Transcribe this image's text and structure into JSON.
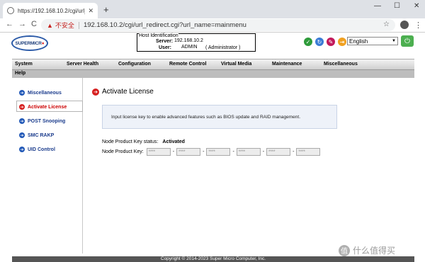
{
  "browser": {
    "tab_title": "https://192.168.10.2/cgi/url_re",
    "tab_close": "✕",
    "new_tab": "+",
    "window_controls": [
      "—",
      "☐",
      "✕"
    ],
    "nav_back": "←",
    "nav_forward": "→",
    "nav_reload": "C",
    "warning_icon": "▲",
    "insecure_label": "不安全",
    "url": "192.168.10.2/cgi/url_redirect.cgi?url_name=mainmenu",
    "star": "☆",
    "menu_dots": "⋮"
  },
  "header": {
    "logo_text": "SUPERMICR",
    "logo_dot": "●",
    "host_title": "Host Identification",
    "server_label": "Server:",
    "server_value": "192.168.10.2",
    "user_label": "User:",
    "user_value": "ADMIN",
    "user_role": "( Administrator )",
    "language": "English",
    "language_arrow": "▼",
    "icons": [
      {
        "name": "check-icon",
        "glyph": "✓",
        "color": "#2e9b3a"
      },
      {
        "name": "refresh-icon",
        "glyph": "↻",
        "color": "#3a7bd5"
      },
      {
        "name": "pen-icon",
        "glyph": "✎",
        "color": "#c2185b"
      },
      {
        "name": "logout-icon",
        "glyph": "⇥",
        "color": "#f0a020"
      }
    ],
    "power_glyph": "⏻"
  },
  "menu": {
    "items": [
      "System",
      "Server Health",
      "Configuration",
      "Remote Control",
      "Virtual Media",
      "Maintenance",
      "Miscellaneous"
    ],
    "sub_item": "Help"
  },
  "sidebar": {
    "items": [
      {
        "label": "Miscellaneous",
        "active": false
      },
      {
        "label": "Activate License",
        "active": true
      },
      {
        "label": "POST Snooping",
        "active": false
      },
      {
        "label": "SMC RAKP",
        "active": false
      },
      {
        "label": "UID Control",
        "active": false
      }
    ],
    "bullet_glyph": "➔"
  },
  "content": {
    "title": "Activate License",
    "info": "Input license key to enable advanced features such as BIOS update and RAID management.",
    "status_label": "Node Product Key status:",
    "status_value": "Activated",
    "key_label": "Node Product Key:",
    "key_placeholder": "****",
    "key_dash": "-"
  },
  "footer": {
    "copyright": "Copyright © 2014-2023 Super Micro Computer, Inc."
  },
  "watermark": {
    "glyph": "值",
    "text": "什么值得买"
  },
  "colors": {
    "brand_blue": "#2158b7",
    "active_red": "#d62020",
    "power_green": "#4caf50"
  }
}
